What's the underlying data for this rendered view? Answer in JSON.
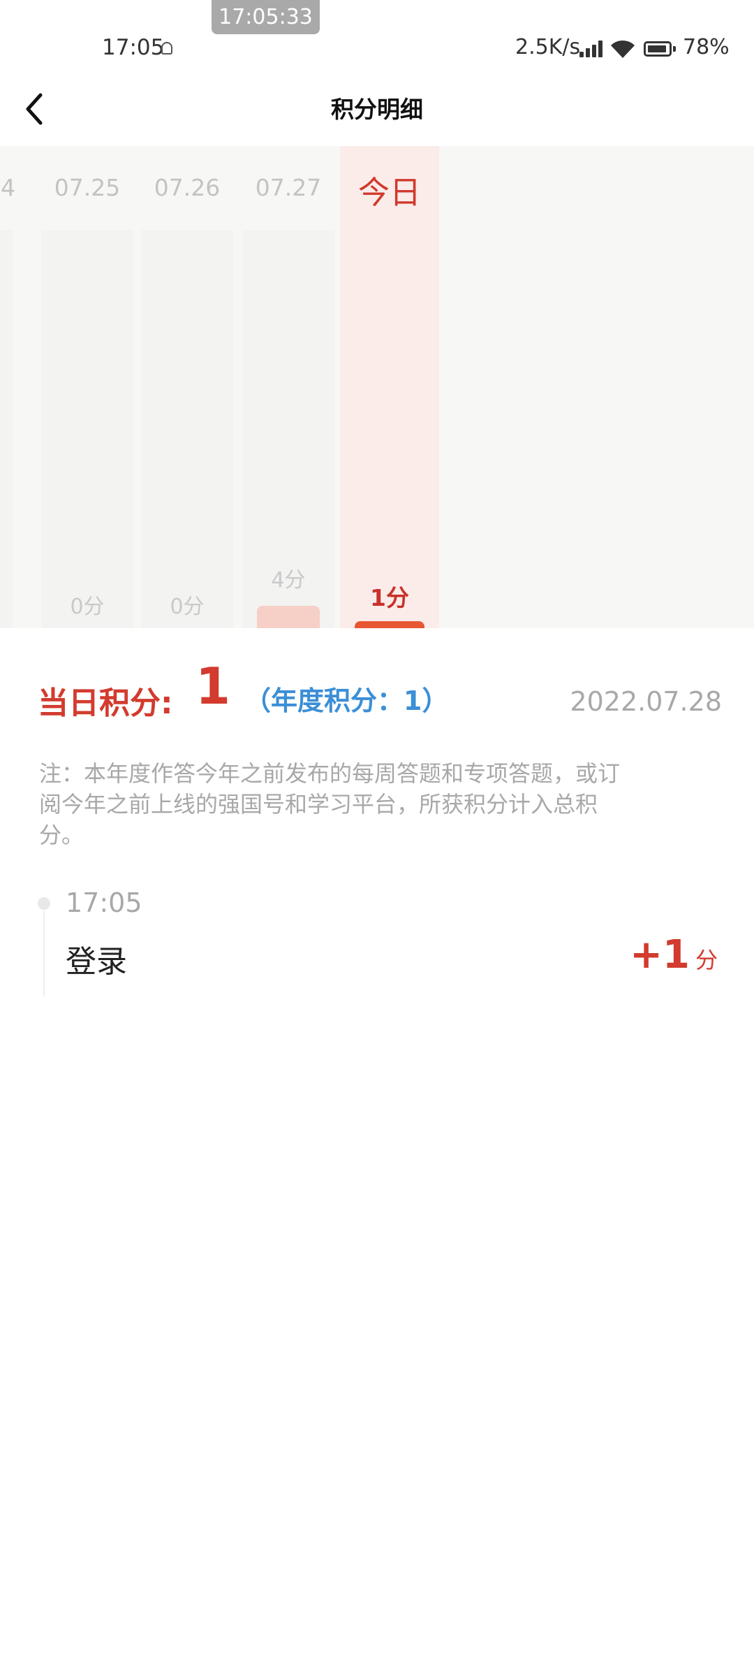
{
  "screenshot_time": "17:05:33",
  "status_bar": {
    "time": "17:05",
    "network_speed": "2.5K/s",
    "battery_level": "78%",
    "icons": [
      "notification-icon",
      "signal-icon",
      "wifi-icon",
      "battery-icon"
    ]
  },
  "header": {
    "title": "积分明细",
    "back_icon": "chevron-left-icon"
  },
  "chart": {
    "columns": [
      {
        "date": "4",
        "score": ""
      },
      {
        "date": "07.25",
        "score": "0分"
      },
      {
        "date": "07.26",
        "score": "0分"
      },
      {
        "date": "07.27",
        "score": "4分"
      },
      {
        "date": "今日",
        "score": "1分"
      }
    ],
    "colors": {
      "today_bg": "#fbecea",
      "today_bar": "#e85633",
      "past_bar": "#f6cfc6"
    }
  },
  "chart_data": {
    "type": "bar",
    "categories": [
      "07.25",
      "07.26",
      "07.27",
      "今日"
    ],
    "values": [
      0,
      0,
      4,
      1
    ]
  },
  "summary": {
    "day_points_label": "当日积分:",
    "day_points_value": "1",
    "year_points": "（年度积分：1）",
    "date": "2022.07.28"
  },
  "note": "注：本年度作答今年之前发布的每周答题和专项答题，或订阅今年之前上线的强国号和学习平台，所获积分计入总积分。",
  "records": [
    {
      "time": "17:05",
      "name": "登录",
      "points": "+1",
      "unit": "分"
    }
  ],
  "colors": {
    "accent_red": "#d23b2e",
    "accent_blue": "#3b8fd6",
    "muted_text": "#a8a8a8"
  }
}
